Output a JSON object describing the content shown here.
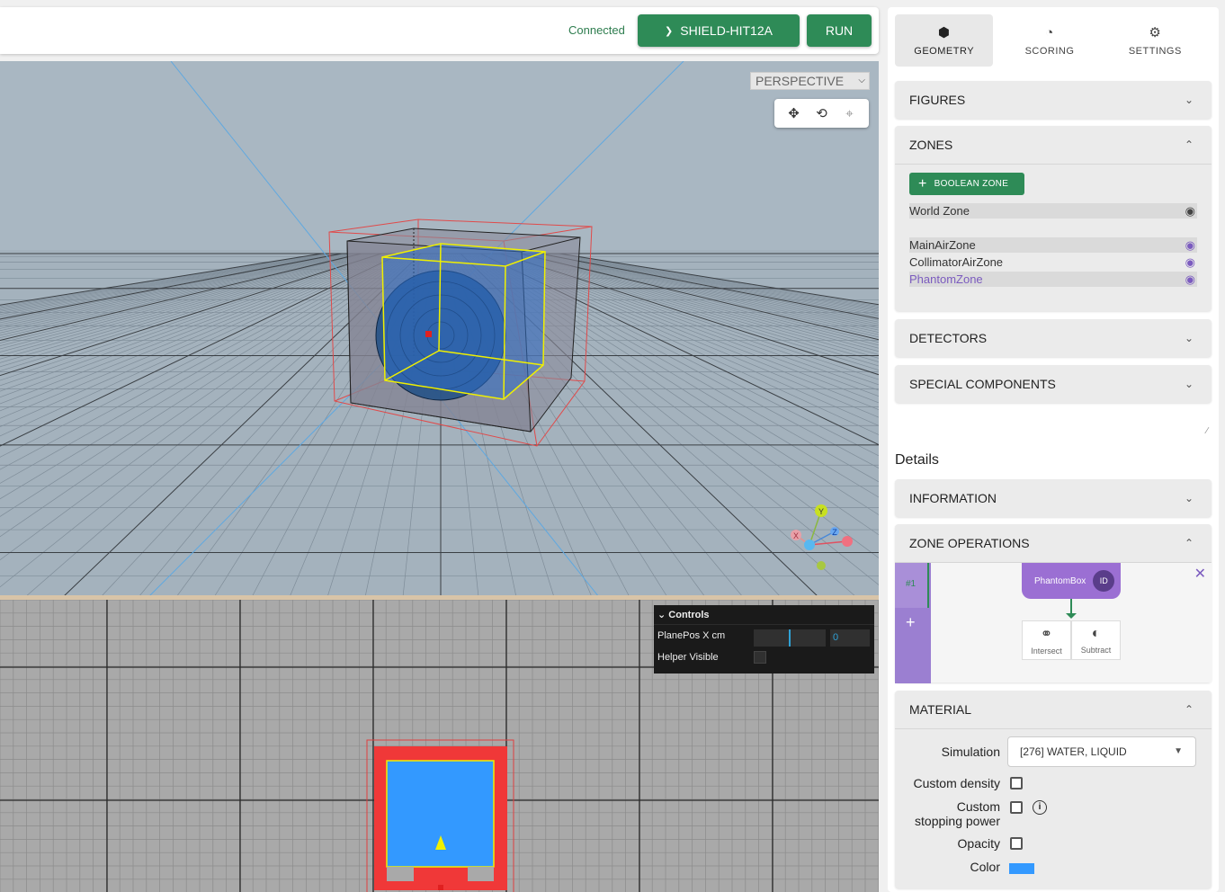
{
  "topbar": {
    "status": "Connected",
    "simulator": "SHIELD-HIT12A",
    "run_label": "RUN"
  },
  "viewport": {
    "camera_mode": "PERSPECTIVE",
    "axis_labels": {
      "x": "X",
      "y": "Y",
      "z": "Z"
    }
  },
  "controls_panel": {
    "title": "Controls",
    "plane_pos_label": "PlanePos X cm",
    "plane_pos_value": "0",
    "helper_visible_label": "Helper Visible"
  },
  "tabs": [
    {
      "label": "GEOMETRY",
      "icon": "cube-icon",
      "active": true
    },
    {
      "label": "SCORING",
      "icon": "gauge-icon",
      "active": false
    },
    {
      "label": "SETTINGS",
      "icon": "gear-icon",
      "active": false
    }
  ],
  "sections": {
    "figures": "FIGURES",
    "zones": "ZONES",
    "detectors": "DETECTORS",
    "special_components": "SPECIAL COMPONENTS",
    "information": "INFORMATION",
    "zone_operations": "ZONE OPERATIONS",
    "material": "MATERIAL"
  },
  "zones": {
    "add_button": "BOOLEAN ZONE",
    "world_zone": "World Zone",
    "items": [
      {
        "name": "MainAirZone",
        "selected": false
      },
      {
        "name": "CollimatorAirZone",
        "selected": false
      },
      {
        "name": "PhantomZone",
        "selected": true
      }
    ]
  },
  "details_heading": "Details",
  "zone_ops": {
    "index": "#1",
    "figure": "PhantomBox",
    "figure_tag": "ID",
    "intersect": "Intersect",
    "subtract": "Subtract"
  },
  "material": {
    "simulation_label": "Simulation",
    "simulation_value": "[276] WATER, LIQUID",
    "custom_density": "Custom density",
    "custom_stopping_power_1": "Custom",
    "custom_stopping_power_2": "stopping power",
    "opacity": "Opacity",
    "color_label": "Color",
    "color_value": "#3399ff"
  },
  "colors": {
    "accent_green": "#2e8b57",
    "accent_purple": "#7b5bbf"
  }
}
